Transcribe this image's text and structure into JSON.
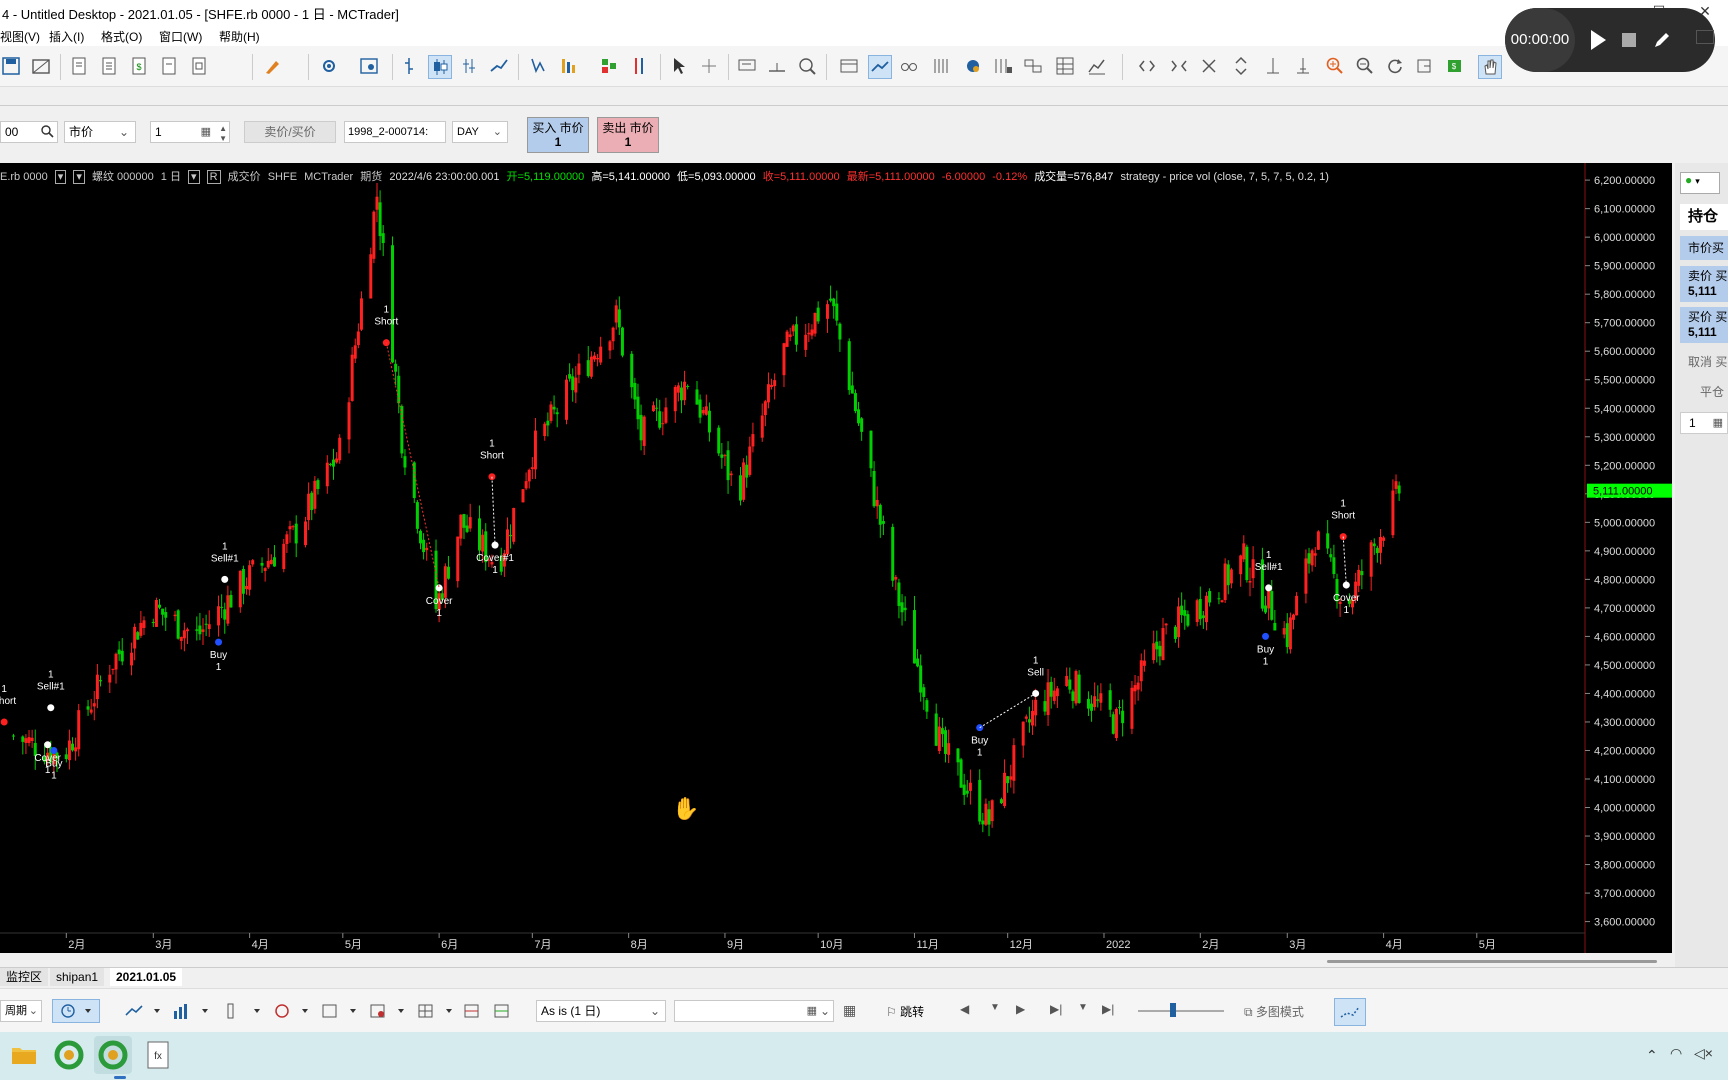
{
  "window": {
    "title": "4 - Untitled Desktop - 2021.01.05 - [SHFE.rb 0000 - 1 日 - MCTrader]",
    "controls": [
      "—",
      "☐",
      "✕"
    ]
  },
  "menu": [
    "视图(V)",
    "插入(I)",
    "格式(O)",
    "窗口(W)",
    "帮助(H)"
  ],
  "recorder": {
    "time": "00:00:00"
  },
  "order_bar": {
    "symbol_partial": "00",
    "price_type": "市价",
    "quantity": "1",
    "bid_ask_label": "卖价/买价",
    "account": "1998_2-000714:",
    "duration": "DAY",
    "buy_button": {
      "label": "买入 市价",
      "qty": "1"
    },
    "sell_button": {
      "label": "卖出 市价",
      "qty": "1"
    }
  },
  "chart": {
    "info": {
      "symbol": "E.rb 0000",
      "sub_symbol": "螺纹 000000",
      "period": "1 日",
      "field": "成交价",
      "exchange": "SHFE",
      "source": "MCTrader",
      "type": "期货",
      "datetime": "2022/4/6  23:00:00.001",
      "open": "开=5,119.00000",
      "high": "高=5,141.00000",
      "low": "低=5,093.00000",
      "close": "收=5,111.00000",
      "last": "最新=5,111.00000",
      "change": "-6.00000",
      "change_pct": "-0.12%",
      "volume": "成交量=576,847",
      "strategy": "strategy - price vol (close,  7,  5,  7,  5,  0.2,  1)"
    },
    "last_price_label": "5,111.00000",
    "y_ticks": [
      "6,200.00000",
      "6,100.00000",
      "6,000.00000",
      "5,900.00000",
      "5,800.00000",
      "5,700.00000",
      "5,600.00000",
      "5,500.00000",
      "5,400.00000",
      "5,300.00000",
      "5,200.00000",
      "5,100.00000",
      "5,000.00000",
      "4,900.00000",
      "4,800.00000",
      "4,700.00000",
      "4,600.00000",
      "4,500.00000",
      "4,400.00000",
      "4,300.00000",
      "4,200.00000",
      "4,100.00000",
      "4,000.00000",
      "3,900.00000",
      "3,800.00000",
      "3,700.00000",
      "3,600.00000"
    ],
    "x_ticks": [
      "2月",
      "3月",
      "4月",
      "5月",
      "6月",
      "7月",
      "8月",
      "9月",
      "10月",
      "11月",
      "12月",
      "2022",
      "2月",
      "3月",
      "4月",
      "5月"
    ],
    "colors": {
      "up": "#ff2020",
      "down": "#00d000",
      "background": "#000000",
      "last_price": "#00ff00"
    }
  },
  "chart_data": {
    "type": "candlestick",
    "x_axis": "date (month labels)",
    "ylim": [
      3560,
      6260
    ],
    "anchor_closes": [
      [
        "2021-01-15",
        4250
      ],
      [
        "2021-01-31",
        4180
      ],
      [
        "2021-02-15",
        4500
      ],
      [
        "2021-03-01",
        4700
      ],
      [
        "2021-03-15",
        4600
      ],
      [
        "2021-03-31",
        4800
      ],
      [
        "2021-04-15",
        4950
      ],
      [
        "2021-04-30",
        5250
      ],
      [
        "2021-05-12",
        6150
      ],
      [
        "2021-05-20",
        5300
      ],
      [
        "2021-05-31",
        4700
      ],
      [
        "2021-06-08",
        5000
      ],
      [
        "2021-06-20",
        4850
      ],
      [
        "2021-07-01",
        5250
      ],
      [
        "2021-07-15",
        5500
      ],
      [
        "2021-07-28",
        5720
      ],
      [
        "2021-08-05",
        5300
      ],
      [
        "2021-08-20",
        5500
      ],
      [
        "2021-09-05",
        5100
      ],
      [
        "2021-09-20",
        5600
      ],
      [
        "2021-10-05",
        5780
      ],
      [
        "2021-10-12",
        5450
      ],
      [
        "2021-10-25",
        4800
      ],
      [
        "2021-11-10",
        4200
      ],
      [
        "2021-11-25",
        3950
      ],
      [
        "2021-12-10",
        4350
      ],
      [
        "2021-12-20",
        4450
      ],
      [
        "2022-01-05",
        4300
      ],
      [
        "2022-01-20",
        4600
      ],
      [
        "2022-02-05",
        4750
      ],
      [
        "2022-02-15",
        4870
      ],
      [
        "2022-03-01",
        4600
      ],
      [
        "2022-03-10",
        4950
      ],
      [
        "2022-03-20",
        4700
      ],
      [
        "2022-04-06",
        5111
      ]
    ],
    "last_bar": {
      "date": "2022-04-06",
      "open": 5119,
      "high": 5141,
      "low": 5093,
      "close": 5111
    },
    "signals": [
      {
        "label": "Short",
        "qty": "1",
        "date": "2021-01-12"
      },
      {
        "label": "Sell#1",
        "qty": "1",
        "date": "2021-01-27"
      },
      {
        "label": "Cover",
        "qty": "1",
        "date": "2021-01-26"
      },
      {
        "label": "Buy",
        "qty": "1",
        "date": "2021-01-28"
      },
      {
        "label": "Sell#1",
        "qty": "1",
        "date": "2021-03-24"
      },
      {
        "label": "Buy",
        "qty": "1",
        "date": "2021-03-22"
      },
      {
        "label": "Short",
        "qty": "1",
        "date": "2021-05-15"
      },
      {
        "label": "Cover",
        "qty": "1",
        "date": "2021-06-01"
      },
      {
        "label": "Short",
        "qty": "1",
        "date": "2021-06-18"
      },
      {
        "label": "Cover#1",
        "qty": "1",
        "date": "2021-06-19"
      },
      {
        "label": "Buy",
        "qty": "1",
        "date": "2021-11-22"
      },
      {
        "label": "Sell",
        "qty": "1",
        "date": "2021-12-10"
      },
      {
        "label": "Sell#1",
        "qty": "1",
        "date": "2022-02-23"
      },
      {
        "label": "Buy",
        "qty": "1",
        "date": "2022-02-22"
      },
      {
        "label": "Short",
        "qty": "1",
        "date": "2022-03-19"
      },
      {
        "label": "Cover",
        "qty": "1",
        "date": "2022-03-20"
      }
    ]
  },
  "right_panel": {
    "position_label": "持仓",
    "market_buy": "市价买",
    "ask_buy_label": "卖价 买",
    "ask_value": "5,111",
    "bid_buy_label": "买价 买",
    "bid_value": "5,111",
    "cancel_buy": "取消 买",
    "flat": "平仓",
    "qty": "1"
  },
  "tabs": [
    "监控区",
    "shipan1",
    "2021.01.05"
  ],
  "bottom_toolbar": {
    "period_label": "周期",
    "resolution": "As is (1 日)",
    "jump_label": "跳转",
    "multi_chart": "多图模式"
  }
}
